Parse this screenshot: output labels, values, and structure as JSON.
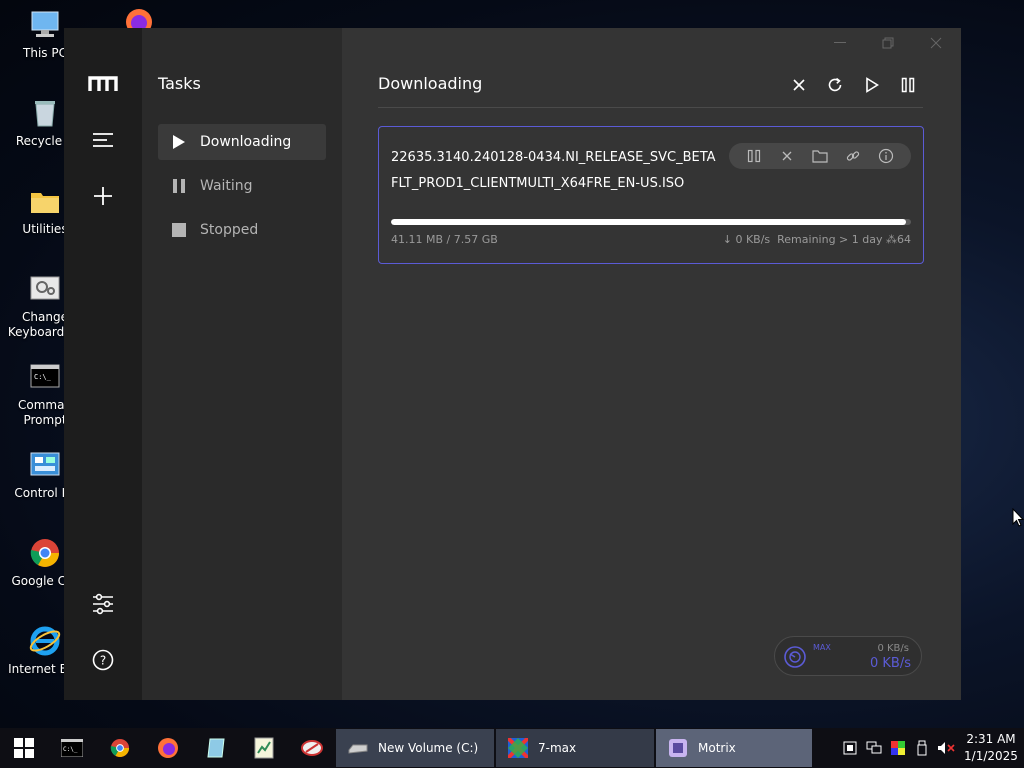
{
  "desktop": {
    "icons": [
      {
        "label": "This PC",
        "icon": "computer-icon"
      },
      {
        "label": "Recycle B",
        "icon": "recycle-bin-icon"
      },
      {
        "label": "Utilities",
        "icon": "folder-icon"
      },
      {
        "label": "Change Keyboard La",
        "icon": "keyboard-settings-icon"
      },
      {
        "label": "Comman Prompt",
        "icon": "command-prompt-icon"
      },
      {
        "label": "Control Pa",
        "icon": "control-panel-icon"
      },
      {
        "label": "Google Chr",
        "icon": "chrome-icon"
      },
      {
        "label": "Internet Exp",
        "icon": "internet-explorer-icon"
      }
    ]
  },
  "app": {
    "name": "Motrix",
    "sidebar_title": "Tasks",
    "nav": [
      "menu-icon",
      "add-icon",
      "settings-icon",
      "help-icon"
    ],
    "filters": [
      {
        "label": "Downloading",
        "icon": "play-icon",
        "active": true
      },
      {
        "label": "Waiting",
        "icon": "pause-icon",
        "active": false
      },
      {
        "label": "Stopped",
        "icon": "stop-icon",
        "active": false
      }
    ],
    "main_title": "Downloading",
    "toolbar": [
      "close-icon",
      "refresh-icon",
      "play-icon",
      "pause-icon"
    ],
    "task": {
      "name": "22635.3140.240128-0434.NI_RELEASE_SVC_BETAFLT_PROD1_CLIENTMULTI_X64FRE_EN-US.ISO",
      "progress_fraction": 0.99,
      "size_text": "41.11 MB / 7.57 GB",
      "speed_text": "↓ 0 KB/s",
      "remaining_text": "Remaining > 1 day",
      "connections_text": "64",
      "actions": [
        "pause-icon",
        "close-icon",
        "folder-icon",
        "link-icon",
        "info-icon"
      ]
    },
    "speedometer": {
      "limit_text": "MAX",
      "upload_text": "0 KB/s",
      "download_text": "0 KB/s"
    }
  },
  "taskbar": {
    "pinned": [
      "start-icon",
      "command-prompt-icon",
      "chrome-icon",
      "firefox-icon",
      "notepad-icon",
      "spreadsheet-icon",
      "tool-icon"
    ],
    "windows": [
      {
        "label": "New Volume (C:)",
        "icon": "drive-icon"
      },
      {
        "label": "7-max",
        "icon": "7max-icon"
      },
      {
        "label": "Motrix",
        "icon": "motrix-icon",
        "active": true
      }
    ],
    "clock_time": "2:31 AM",
    "clock_date": "1/1/2025"
  },
  "colors": {
    "accent": "#5b5bd6",
    "window_bg": "#343434",
    "sidebar_bg": "#2a2a2a",
    "nav_bg": "#1d1d1d"
  }
}
